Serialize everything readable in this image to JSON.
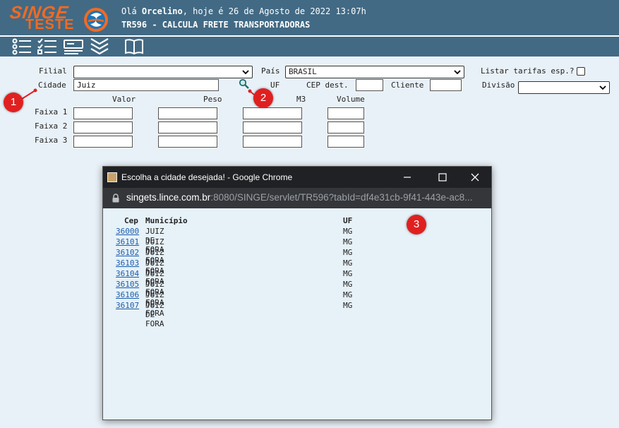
{
  "header": {
    "logo_text": "SINGE",
    "logo_subtext": "TESTE",
    "greeting_prefix": "Olá ",
    "user_name": "Orcelino",
    "greeting_suffix": ", hoje é 26 de Agosto de 2022 13:07h",
    "program_title": "TR596 - CALCULA FRETE TRANSPORTADORAS"
  },
  "toolbar": {
    "icons": [
      "list-icon",
      "checklist-icon",
      "print-icon",
      "collapse-icon",
      "manual-book-icon"
    ]
  },
  "form": {
    "filial_label": "Filial",
    "filial_value": "",
    "pais_label": "País",
    "pais_value": "BRASIL",
    "listar_tarifas_label": "Listar tarifas esp.?",
    "listar_tarifas_checked": false,
    "cidade_label": "Cidade",
    "cidade_value": "Juiz",
    "uf_label": "UF",
    "cep_dest_label": "CEP dest.",
    "cep_dest_value": "",
    "cliente_label": "Cliente",
    "cliente_value": "",
    "divisao_label": "Divisão",
    "divisao_value": "",
    "columns": [
      "Valor",
      "Peso",
      "M3",
      "Volume"
    ],
    "faixas": [
      {
        "label": "Faixa 1",
        "valor": "",
        "peso": "",
        "m3": "",
        "volume": ""
      },
      {
        "label": "Faixa 2",
        "valor": "",
        "peso": "",
        "m3": "",
        "volume": ""
      },
      {
        "label": "Faixa 3",
        "valor": "",
        "peso": "",
        "m3": "",
        "volume": ""
      }
    ]
  },
  "markers": [
    "1",
    "2",
    "3"
  ],
  "popup": {
    "title": "Escolha a cidade desejada! - Google Chrome",
    "url_host": "singets.lince.com.br",
    "url_rest": ":8080/SINGE/servlet/TR596?tabId=df4e31cb-9f41-443e-ac8...",
    "headers": {
      "cep": "Cep",
      "municipio": "Município",
      "uf": "UF"
    },
    "rows": [
      {
        "cep": "36000",
        "municipio": "JUIZ DE FORA",
        "uf": "MG"
      },
      {
        "cep": "36101",
        "municipio": "JUIZ DE FORA",
        "uf": "MG"
      },
      {
        "cep": "36102",
        "municipio": "JUIZ DE FORA",
        "uf": "MG"
      },
      {
        "cep": "36103",
        "municipio": "JUIZ DE FORA",
        "uf": "MG"
      },
      {
        "cep": "36104",
        "municipio": "JUIZ DE FORA",
        "uf": "MG"
      },
      {
        "cep": "36105",
        "municipio": "JUIZ DE FORA",
        "uf": "MG"
      },
      {
        "cep": "36106",
        "municipio": "JUIZ DE FORA",
        "uf": "MG"
      },
      {
        "cep": "36107",
        "municipio": "JUIZ DE FORA",
        "uf": "MG"
      }
    ]
  },
  "colors": {
    "header_bg": "#426a84",
    "logo_orange": "#f26a22",
    "page_bg": "#e9f1f8",
    "marker_red": "#e02020",
    "link_blue": "#1a5dab"
  }
}
